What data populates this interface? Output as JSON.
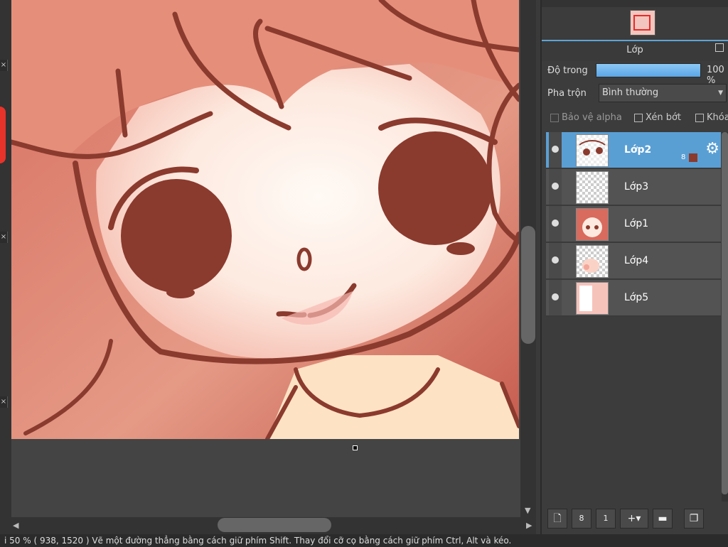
{
  "panel": {
    "header_title": "Lớp",
    "opacity_label": "Độ trong",
    "opacity_value": "100 %",
    "opacity_fraction": 1.0,
    "blend_label": "Pha trộn",
    "blend_value": "Bình thường",
    "checks": {
      "alpha_protect": "Bảo vệ alpha",
      "clipping": "Xén bớt",
      "lock": "Khóa"
    },
    "layers": [
      {
        "name": "Lớp2",
        "selected": true,
        "badge": "8"
      },
      {
        "name": "Lớp3",
        "selected": false
      },
      {
        "name": "Lớp1",
        "selected": false
      },
      {
        "name": "Lớp4",
        "selected": false
      },
      {
        "name": "Lớp5",
        "selected": false
      }
    ]
  },
  "status": {
    "text": "i 50 % ( 938, 1520 ) Vẽ một đường thẳng bằng cách giữ phím Shift. Thay đổi cỡ cọ bằng cách giữ phím Ctrl, Alt và kéo."
  },
  "colors": {
    "accent": "#5a9fd4",
    "stroke": "#8b3a2e"
  },
  "icons": {
    "eye": "eye-icon",
    "gear": "gear-icon",
    "new_layer": "new-layer-icon",
    "new_8bit_layer": "new-8bit-layer-icon",
    "new_1bit_layer": "new-1bit-layer-icon",
    "add_layer_menu": "add-layer-menu-icon",
    "folder": "folder-icon",
    "duplicate": "duplicate-layer-icon",
    "popout": "popout-icon"
  }
}
